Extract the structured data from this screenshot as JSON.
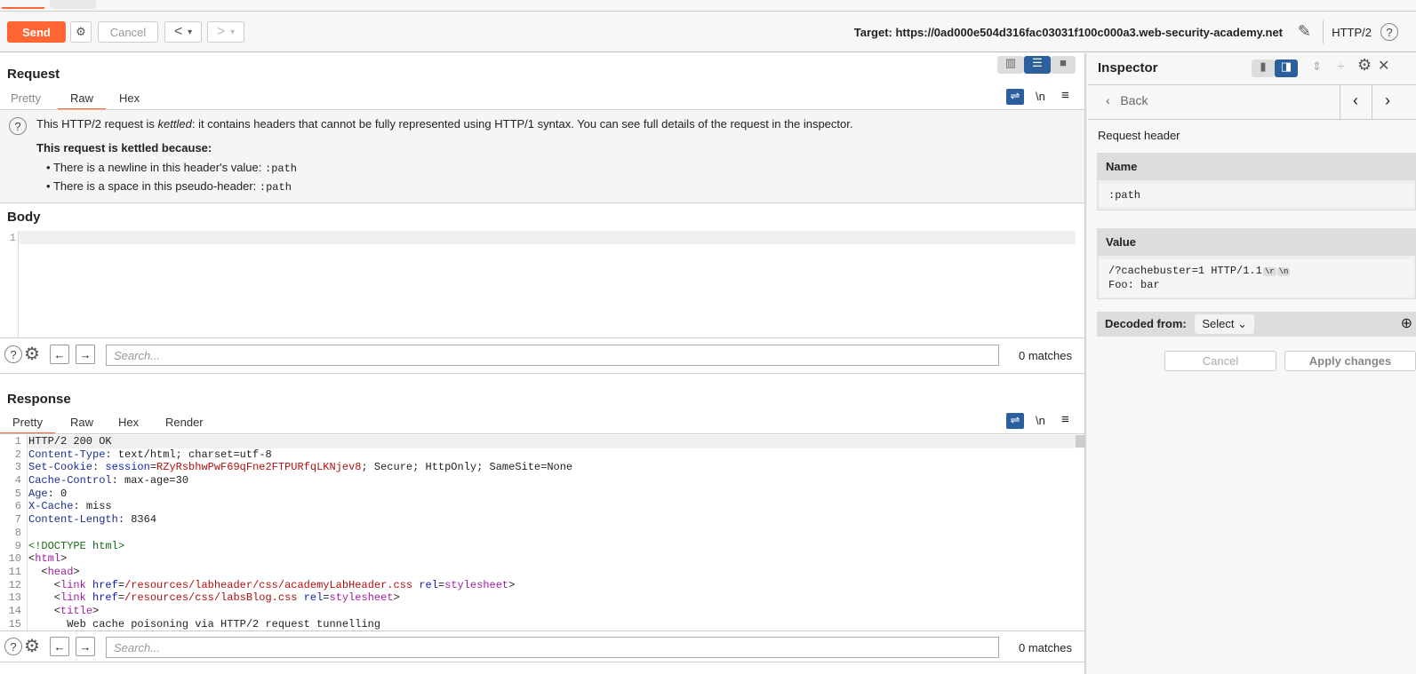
{
  "toolbar": {
    "send": "Send",
    "cancel": "Cancel",
    "back": "<",
    "forward": ">",
    "dropdown": "▾",
    "target": "Target: https://0ad000e504d316fac03031f100c000a3.web-security-academy.net",
    "protocol": "HTTP/2",
    "help": "?"
  },
  "request": {
    "title": "Request",
    "tabs": [
      "Pretty",
      "Raw",
      "Hex"
    ],
    "active_tab": "Raw",
    "wrap": "⇌",
    "newline": "\\n",
    "menu": "≡",
    "notice": {
      "pre": "This HTTP/2 request is ",
      "em": "kettled",
      "post": ": it contains headers that cannot be fully represented using HTTP/1 syntax. You can see full details of the request in the inspector.",
      "reason_title": "This request is kettled because:",
      "reasons": [
        {
          "text": "There is a newline in this header's value: ",
          "code": ":path"
        },
        {
          "text": "There is a space in this pseudo-header: ",
          "code": ":path"
        }
      ]
    },
    "body_title": "Body",
    "body_lines": [
      "1"
    ]
  },
  "search_top": {
    "placeholder": "Search...",
    "matches": "0 matches"
  },
  "response": {
    "title": "Response",
    "tabs": [
      "Pretty",
      "Raw",
      "Hex",
      "Render"
    ],
    "active_tab": "Pretty",
    "lines": [
      [
        [
          "v",
          "HTTP/2 200 OK"
        ]
      ],
      [
        [
          "k",
          "Content-Type"
        ],
        [
          "v",
          ": text/html; charset=utf-8"
        ]
      ],
      [
        [
          "k",
          "Set-Cookie"
        ],
        [
          "v",
          ": "
        ],
        [
          "b",
          "session"
        ],
        [
          "v",
          "="
        ],
        [
          "r",
          "RZyRsbhwPwF69qFne2FTPURfqLKNjev8"
        ],
        [
          "v",
          "; Secure; HttpOnly; SameSite=None"
        ]
      ],
      [
        [
          "k",
          "Cache-Control"
        ],
        [
          "v",
          ": max-age=30"
        ]
      ],
      [
        [
          "k",
          "Age"
        ],
        [
          "v",
          ": 0"
        ]
      ],
      [
        [
          "k",
          "X-Cache"
        ],
        [
          "v",
          ": miss"
        ]
      ],
      [
        [
          "k",
          "Content-Length"
        ],
        [
          "v",
          ": 8364"
        ]
      ],
      [],
      [
        [
          "g",
          "<!DOCTYPE html>"
        ]
      ],
      [
        [
          "v",
          "<"
        ],
        [
          "p",
          "html"
        ],
        [
          "v",
          ">"
        ]
      ],
      [
        [
          "v",
          "  <"
        ],
        [
          "p",
          "head"
        ],
        [
          "v",
          ">"
        ]
      ],
      [
        [
          "v",
          "    <"
        ],
        [
          "p",
          "link"
        ],
        [
          "v",
          " "
        ],
        [
          "b",
          "href"
        ],
        [
          "v",
          "="
        ],
        [
          "r",
          "/resources/labheader/css/academyLabHeader.css"
        ],
        [
          "v",
          " "
        ],
        [
          "b",
          "rel"
        ],
        [
          "v",
          "="
        ],
        [
          "p",
          "stylesheet"
        ],
        [
          "v",
          ">"
        ]
      ],
      [
        [
          "v",
          "    <"
        ],
        [
          "p",
          "link"
        ],
        [
          "v",
          " "
        ],
        [
          "b",
          "href"
        ],
        [
          "v",
          "="
        ],
        [
          "r",
          "/resources/css/labsBlog.css"
        ],
        [
          "v",
          " "
        ],
        [
          "b",
          "rel"
        ],
        [
          "v",
          "="
        ],
        [
          "p",
          "stylesheet"
        ],
        [
          "v",
          ">"
        ]
      ],
      [
        [
          "v",
          "    <"
        ],
        [
          "p",
          "title"
        ],
        [
          "v",
          ">"
        ]
      ],
      [
        [
          "v",
          "      Web cache poisoning via HTTP/2 request tunnelling"
        ]
      ]
    ]
  },
  "search_bottom": {
    "placeholder": "Search...",
    "matches": "0 matches"
  },
  "inspector": {
    "title": "Inspector",
    "back": "Back",
    "section": "Request header",
    "name_label": "Name",
    "name_value": ":path",
    "value_label": "Value",
    "value_line1": "/?cachebuster=1 HTTP/1.1",
    "cr": "\\r",
    "lf": "\\n",
    "value_line2": "Foo: bar",
    "decoded_label": "Decoded from:",
    "decoded_select": "Select",
    "cancel": "Cancel",
    "apply": "Apply changes"
  },
  "colors": {
    "accent": "#ff6633",
    "active_blue": "#2b5f9e"
  }
}
